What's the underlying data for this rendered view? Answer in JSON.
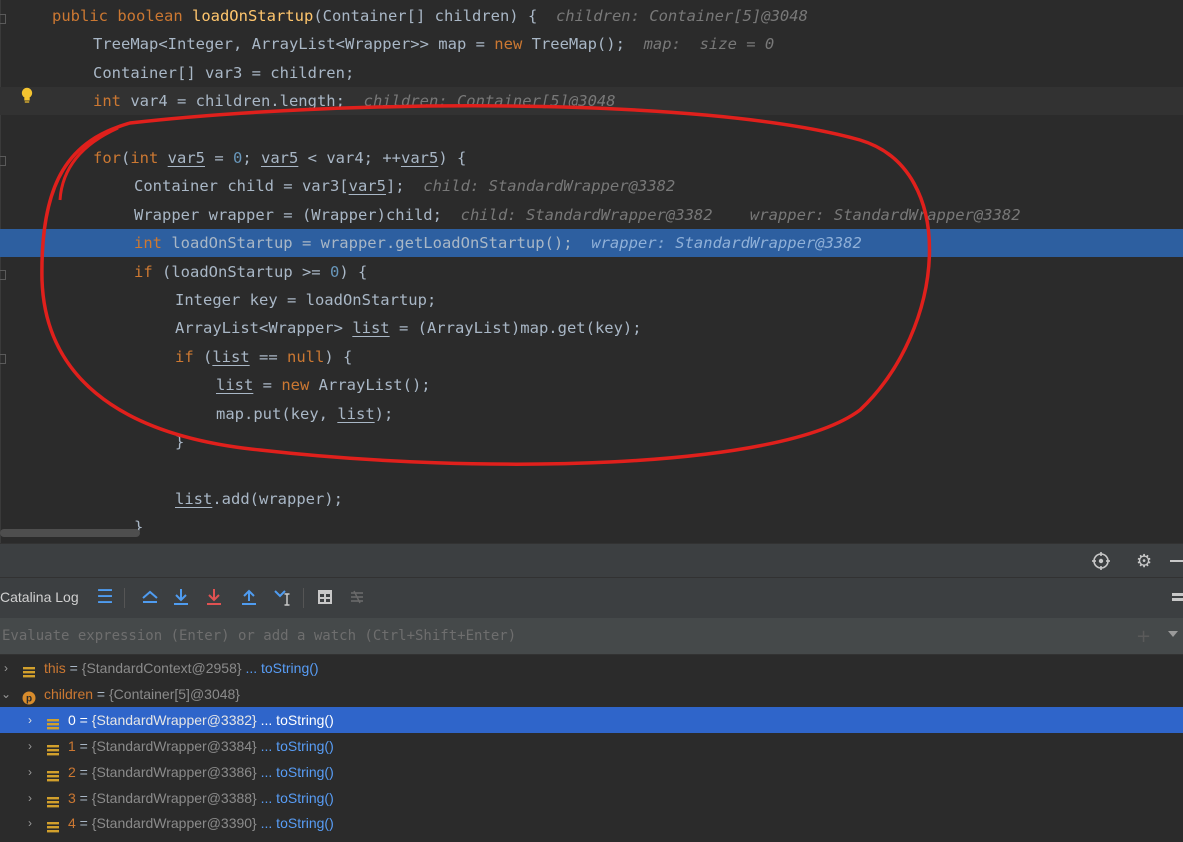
{
  "editor": {
    "lines": [
      {
        "segments": [
          {
            "t": "public boolean ",
            "c": "kw"
          },
          {
            "t": "loadOnStartup",
            "c": "fn"
          },
          {
            "t": "(Container[] children) {  "
          },
          {
            "t": "children: Container[5]@3048",
            "c": "hint"
          }
        ]
      },
      {
        "segments": [
          {
            "t": "TreeMap<Integer, ArrayList<Wrapper>> map = "
          },
          {
            "t": "new ",
            "c": "kw"
          },
          {
            "t": "TreeMap();  "
          },
          {
            "t": "map:  size = 0",
            "c": "hint"
          }
        ]
      },
      {
        "segments": [
          {
            "t": "Container[] var3 = children;"
          }
        ]
      },
      {
        "segments": [
          {
            "t": "int ",
            "c": "kw"
          },
          {
            "t": "var4 = children.length;  "
          },
          {
            "t": "children: Container[5]@3048",
            "c": "hint"
          }
        ]
      },
      {
        "segments": []
      },
      {
        "segments": [
          {
            "t": "for",
            "c": "kw"
          },
          {
            "t": "("
          },
          {
            "t": "int ",
            "c": "kw"
          },
          {
            "t": "var5",
            "c": "ul"
          },
          {
            "t": " = "
          },
          {
            "t": "0",
            "c": "num"
          },
          {
            "t": "; "
          },
          {
            "t": "var5",
            "c": "ul"
          },
          {
            "t": " < var4; ++"
          },
          {
            "t": "var5",
            "c": "ul"
          },
          {
            "t": ") {"
          }
        ]
      },
      {
        "segments": [
          {
            "t": "Container child = var3["
          },
          {
            "t": "var5",
            "c": "ul"
          },
          {
            "t": "];  "
          },
          {
            "t": "child: StandardWrapper@3382",
            "c": "hint"
          }
        ]
      },
      {
        "segments": [
          {
            "t": "Wrapper wrapper = (Wrapper)child;  "
          },
          {
            "t": "child: StandardWrapper@3382    wrapper: StandardWrapper@3382",
            "c": "hint"
          }
        ]
      },
      {
        "segments": [
          {
            "t": "int ",
            "c": "kw"
          },
          {
            "t": "loadOnStartup = wrapper.getLoadOnStartup();  "
          },
          {
            "t": "wrapper: StandardWrapper@3382",
            "c": "hint"
          }
        ]
      },
      {
        "segments": [
          {
            "t": "if ",
            "c": "kw"
          },
          {
            "t": "(loadOnStartup >= "
          },
          {
            "t": "0",
            "c": "num"
          },
          {
            "t": ") {"
          }
        ]
      },
      {
        "segments": [
          {
            "t": "Integer key = loadOnStartup;"
          }
        ]
      },
      {
        "segments": [
          {
            "t": "ArrayList<Wrapper> "
          },
          {
            "t": "list",
            "c": "ul"
          },
          {
            "t": " = (ArrayList)map.get(key);"
          }
        ]
      },
      {
        "segments": [
          {
            "t": "if ",
            "c": "kw"
          },
          {
            "t": "("
          },
          {
            "t": "list",
            "c": "ul"
          },
          {
            "t": " == "
          },
          {
            "t": "null",
            "c": "kw"
          },
          {
            "t": ") {"
          }
        ]
      },
      {
        "segments": [
          {
            "t": "list",
            "c": "ul"
          },
          {
            "t": " = "
          },
          {
            "t": "new ",
            "c": "kw"
          },
          {
            "t": "ArrayList();"
          }
        ]
      },
      {
        "segments": [
          {
            "t": "map.put(key, "
          },
          {
            "t": "list",
            "c": "ul"
          },
          {
            "t": ");"
          }
        ]
      },
      {
        "segments": [
          {
            "t": "}"
          }
        ]
      },
      {
        "segments": []
      },
      {
        "segments": [
          {
            "t": "list",
            "c": "ul"
          },
          {
            "t": ".add(wrapper);"
          }
        ]
      },
      {
        "segments": [
          {
            "t": "}"
          }
        ]
      }
    ],
    "current_line": 3,
    "execution_line": 8
  },
  "debugger": {
    "tab_label": "Catalina Log",
    "header_icons": [
      "crosshair-icon",
      "gear-icon",
      "minimize-icon"
    ],
    "toolbar_icons": [
      "menu-icon",
      "show-execution-point-icon",
      "step-over-icon",
      "step-into-icon",
      "step-out-icon",
      "run-to-cursor-icon",
      "evaluate-icon",
      "trace-icon"
    ],
    "eval_placeholder": "Evaluate expression (Enter) or add a watch (Ctrl+Shift+Enter)",
    "variables": [
      {
        "name": "this",
        "value": "{StandardContext@2958}",
        "link": "... toString()",
        "expanded": false,
        "icon": "field",
        "selected": false
      },
      {
        "name": "children",
        "value": "{Container[5]@3048}",
        "link": "",
        "expanded": true,
        "icon": "param",
        "selected": false
      },
      {
        "name": "0",
        "value": "{StandardWrapper@3382}",
        "link": "... toString()",
        "expanded": false,
        "icon": "field",
        "selected": true
      },
      {
        "name": "1",
        "value": "{StandardWrapper@3384}",
        "link": "... toString()",
        "expanded": false,
        "icon": "field",
        "selected": false
      },
      {
        "name": "2",
        "value": "{StandardWrapper@3386}",
        "link": "... toString()",
        "expanded": false,
        "icon": "field",
        "selected": false
      },
      {
        "name": "3",
        "value": "{StandardWrapper@3388}",
        "link": "... toString()",
        "expanded": false,
        "icon": "field",
        "selected": false
      },
      {
        "name": "4",
        "value": "{StandardWrapper@3390}",
        "link": "... toString()",
        "expanded": false,
        "icon": "field",
        "selected": false
      }
    ],
    "colors": {
      "selection": "#2f65ca",
      "execution_line": "#2d5fa0",
      "annotation_circle": "#e0201c"
    }
  }
}
